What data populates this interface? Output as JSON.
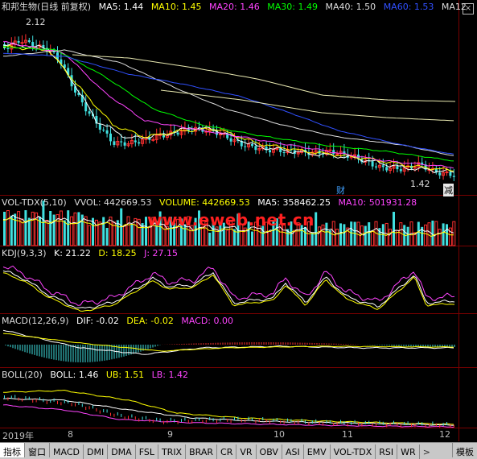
{
  "main": {
    "title": "和邦生物(日线 前复权)",
    "ma5": "MA5: 1.44",
    "ma10": "MA10: 1.45",
    "ma20": "MA20: 1.46",
    "ma30": "MA30: 1.49",
    "ma40": "MA40: 1.50",
    "ma60": "MA60: 1.53",
    "ma120": "MA12",
    "high_label": "2.12",
    "low_label": "1.42",
    "cai_mark": "财",
    "jian_mark": "减",
    "close_glyph": "×"
  },
  "volume": {
    "name": "VOL-TDX(5,10)",
    "vvol": "VVOL: 442669.53",
    "volume": "VOLUME: 442669.53",
    "ma5": "MA5: 358462.25",
    "ma10": "MA10: 501931.28"
  },
  "kdj": {
    "name": "KDJ(9,3,3)",
    "k": "K: 21.22",
    "d": "D: 18.25",
    "j": "J: 27.15"
  },
  "macd": {
    "name": "MACD(12,26,9)",
    "dif": "DIF: -0.02",
    "dea": "DEA: -0.02",
    "macd": "MACD: 0.00"
  },
  "boll": {
    "name": "BOLL(20)",
    "boll": "BOLL: 1.46",
    "ub": "UB: 1.51",
    "lb": "LB: 1.42"
  },
  "timeaxis": {
    "year": "2019年",
    "months": [
      "8",
      "9",
      "10",
      "11",
      "12"
    ]
  },
  "watermark": "www.eweb.net.cn",
  "tabs": [
    "指标",
    "窗口",
    "MACD",
    "DMI",
    "DMA",
    "FSL",
    "TRIX",
    "BRAR",
    "CR",
    "VR",
    "OBV",
    "ASI",
    "EMV",
    "VOL-TDX",
    "RSI",
    "WR"
  ],
  "tab_more": ">",
  "tab_right": "模板",
  "colors": {
    "ma5": "#ffffff",
    "ma10": "#ffff00",
    "ma20": "#ff44ff",
    "ma30": "#00ff00",
    "ma40": "#dddddd",
    "ma60": "#3050ff",
    "up": "#ff3030",
    "down": "#40e0e0",
    "k": "#ffffff",
    "d": "#ffff00",
    "j": "#ff44ff"
  }
}
